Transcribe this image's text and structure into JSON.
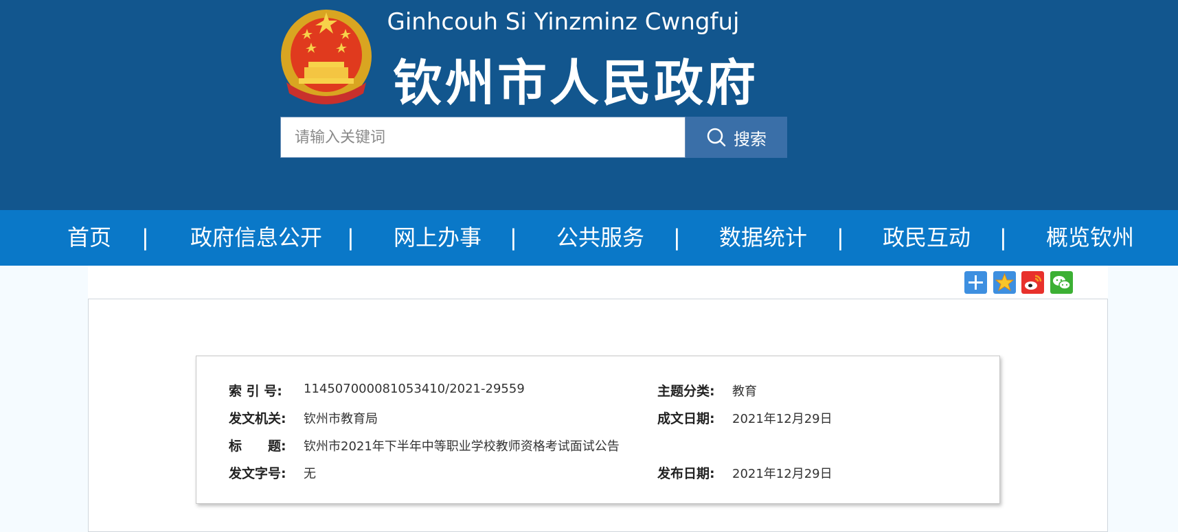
{
  "header": {
    "pinyin_title": "Ginhcouh Si Yinzminz Cwngfuj",
    "cn_title": "钦州市人民政府",
    "emblem_icon": "national-emblem-icon"
  },
  "search": {
    "placeholder": "请输入关键词",
    "button_label": "搜索"
  },
  "nav": {
    "items": [
      {
        "label": "首页"
      },
      {
        "label": "政府信息公开"
      },
      {
        "label": "网上办事"
      },
      {
        "label": "公共服务"
      },
      {
        "label": "数据统计"
      },
      {
        "label": "政民互动"
      },
      {
        "label": "概览钦州"
      }
    ],
    "separator": "|"
  },
  "share": {
    "icons": [
      "add-icon",
      "favorite-star-icon",
      "weibo-icon",
      "wechat-icon"
    ]
  },
  "info": {
    "index_label": "索 引 号:",
    "index_value": "114507000081053410/2021-29559",
    "topic_label": "主题分类:",
    "topic_value": "教育",
    "issuer_label": "发文机关:",
    "issuer_value": "钦州市教育局",
    "written_date_label": "成文日期:",
    "written_date_value": "2021年12月29日",
    "title_label": "标　　题:",
    "title_value": "钦州市2021年下半年中等职业学校教师资格考试面试公告",
    "doc_no_label": "发文字号:",
    "doc_no_value": "无",
    "publish_date_label": "发布日期:",
    "publish_date_value": "2021年12月29日"
  },
  "colors": {
    "header_bg": "#12568e",
    "nav_bg": "#0a78c8",
    "search_button_bg": "#3a6fa8"
  }
}
